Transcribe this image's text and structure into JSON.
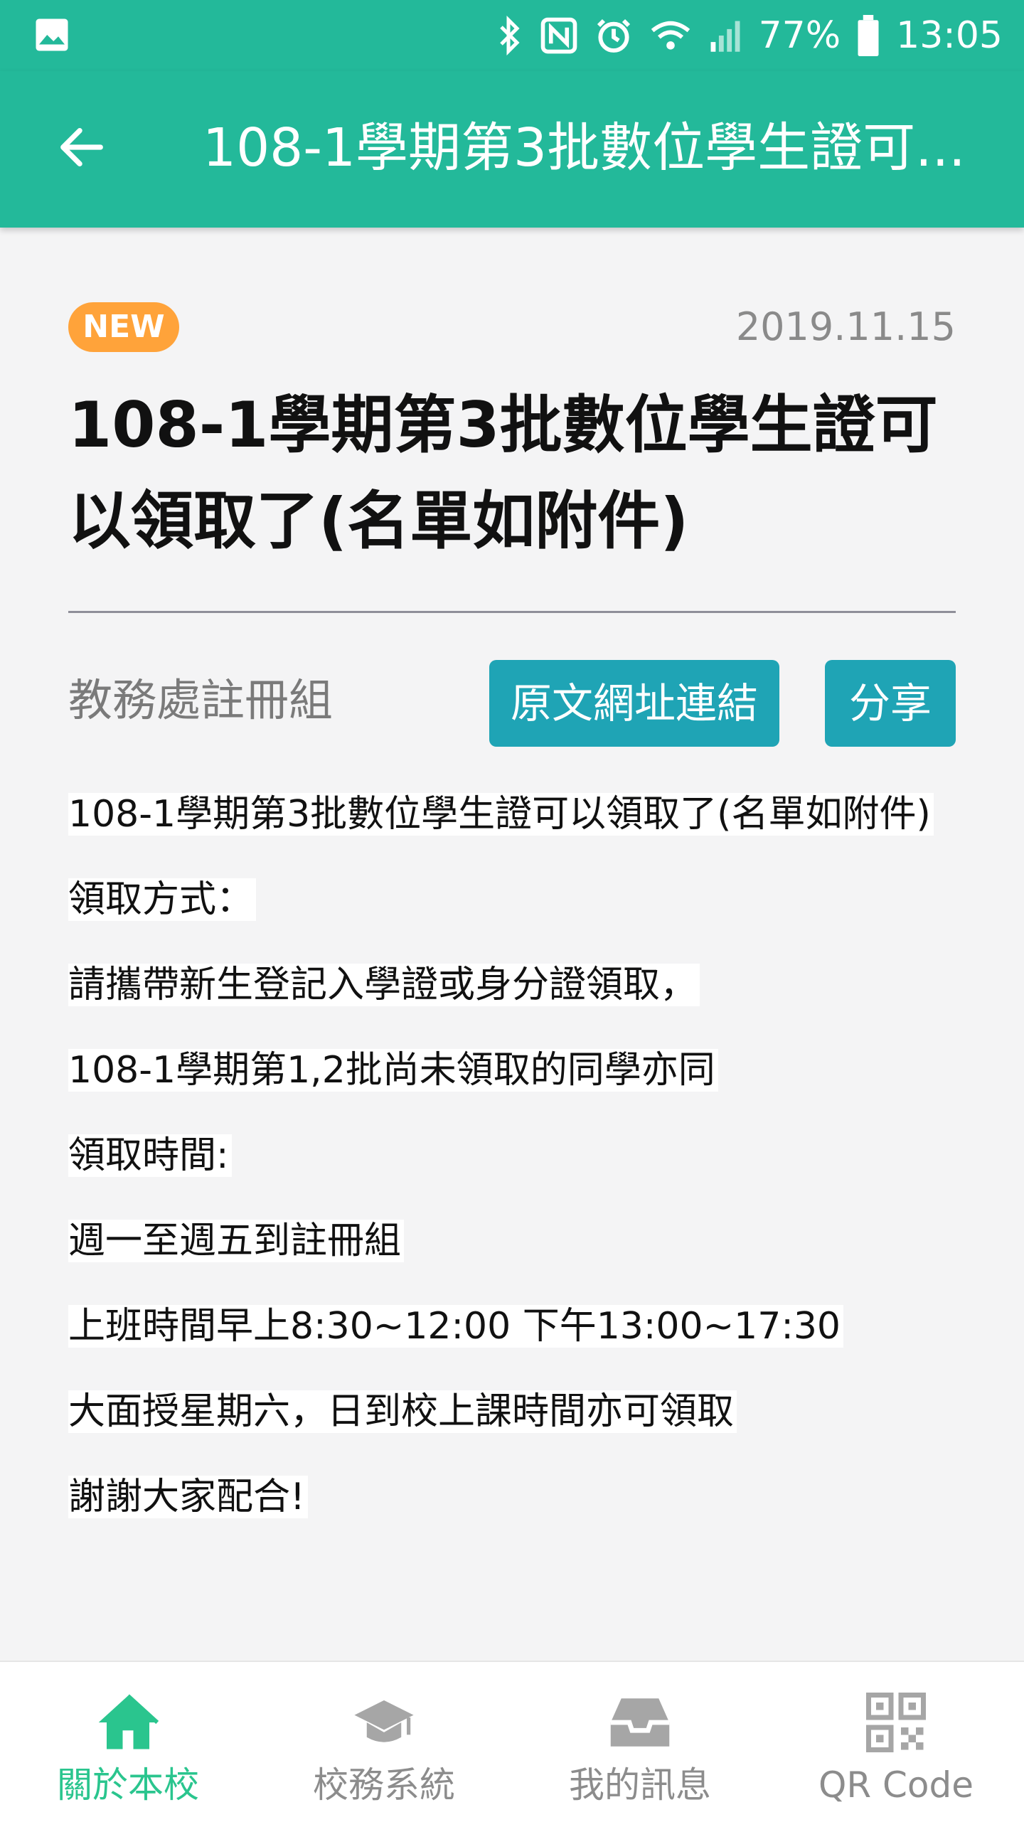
{
  "status_bar": {
    "battery": "77%",
    "time": "13:05",
    "icons": [
      "image-icon",
      "bluetooth-icon",
      "nfc-icon",
      "alarm-icon",
      "wifi-icon",
      "signal-icon",
      "battery-icon"
    ]
  },
  "app_bar": {
    "title": "108-1學期第3批數位學生證可...",
    "back_icon": "arrow-back-icon"
  },
  "post": {
    "badge": "NEW",
    "date": "2019.11.15",
    "title": "108-1學期第3批數位學生證可以領取了(名單如附件)",
    "department": "教務處註冊組",
    "link_button": "原文網址連結",
    "share_button": "分享",
    "body_lines": [
      "108-1學期第3批數位學生證可以領取了(名單如附件)",
      "領取方式：",
      "請攜帶新生登記入學證或身分證領取，",
      "108-1學期第1,2批尚未領取的同學亦同",
      "領取時間:",
      "週一至週五到註冊組",
      "上班時間早上8:30~12:00 下午13:00~17:30",
      "大面授星期六，日到校上課時間亦可領取",
      "謝謝大家配合!"
    ]
  },
  "bottom_nav": {
    "items": [
      {
        "label": "關於本校",
        "icon": "home-icon",
        "active": true
      },
      {
        "label": "校務系統",
        "icon": "graduation-cap-icon",
        "active": false
      },
      {
        "label": "我的訊息",
        "icon": "inbox-icon",
        "active": false
      },
      {
        "label": "QR Code",
        "icon": "qr-code-icon",
        "active": false
      }
    ]
  },
  "colors": {
    "primary": "#23b99a",
    "badge": "#ffa33a",
    "button": "#1fa4b5",
    "nav_active": "#2ac58e",
    "nav_inactive": "#8c8c8c"
  }
}
